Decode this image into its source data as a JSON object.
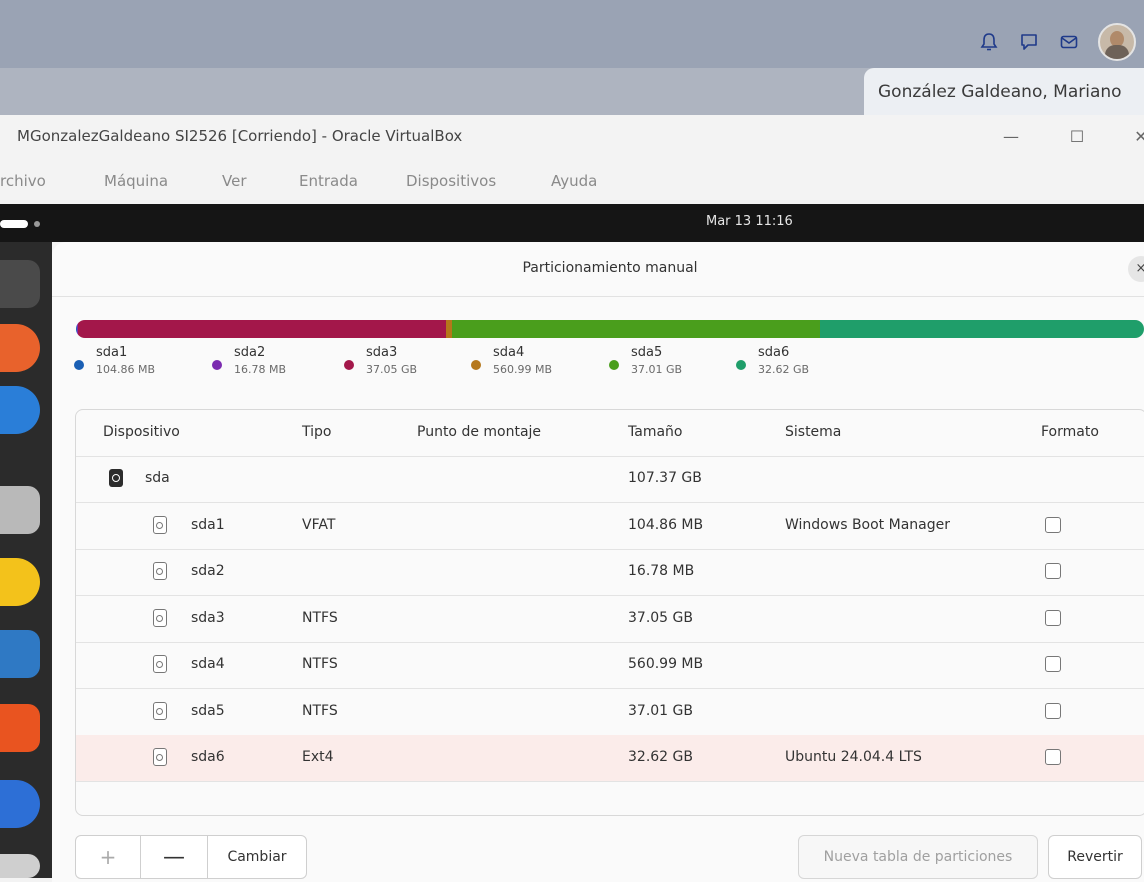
{
  "host": {
    "user_name": "González Galdeano, Mariano",
    "icons": [
      "bell-icon",
      "chat-icon",
      "mail-icon"
    ]
  },
  "vbox": {
    "title": "MGonzalezGaldeano SI2526 [Corriendo] - Oracle VirtualBox",
    "menu": [
      "rchivo",
      "Máquina",
      "Ver",
      "Entrada",
      "Dispositivos",
      "Ayuda"
    ]
  },
  "vm": {
    "clock": "Mar 13  11:16"
  },
  "dialog": {
    "title": "Particionamiento manual",
    "close": "×"
  },
  "partitions_bar": [
    {
      "name": "sda1",
      "size": "104.86 MB",
      "color": "#1a5fb4",
      "fraction": 0.001
    },
    {
      "name": "sda2",
      "size": "16.78 MB",
      "color": "#7b2bb0",
      "fraction": 0.0002
    },
    {
      "name": "sda3",
      "size": "37.05 GB",
      "color": "#a3174a",
      "fraction": 0.345
    },
    {
      "name": "sda4",
      "size": "560.99 MB",
      "color": "#b5771b",
      "fraction": 0.005
    },
    {
      "name": "sda5",
      "size": "37.01 GB",
      "color": "#4a9e1c",
      "fraction": 0.345
    },
    {
      "name": "sda6",
      "size": "32.62 GB",
      "color": "#1f9e6a",
      "fraction": 0.304
    }
  ],
  "table": {
    "headers": {
      "device": "Dispositivo",
      "type": "Tipo",
      "mount": "Punto de montaje",
      "size": "Tamaño",
      "system": "Sistema",
      "format": "Formato"
    },
    "disk": {
      "device": "sda",
      "size": "107.37 GB"
    },
    "rows": [
      {
        "device": "sda1",
        "type": "VFAT",
        "size": "104.86 MB",
        "system": "Windows Boot Manager"
      },
      {
        "device": "sda2",
        "type": "",
        "size": "16.78 MB",
        "system": ""
      },
      {
        "device": "sda3",
        "type": "NTFS",
        "size": "37.05 GB",
        "system": ""
      },
      {
        "device": "sda4",
        "type": "NTFS",
        "size": "560.99 MB",
        "system": ""
      },
      {
        "device": "sda5",
        "type": "NTFS",
        "size": "37.01 GB",
        "system": ""
      },
      {
        "device": "sda6",
        "type": "Ext4",
        "size": "32.62 GB",
        "system": "Ubuntu 24.04.4 LTS"
      }
    ]
  },
  "buttons": {
    "plus": "+",
    "minus": "—",
    "change": "Cambiar",
    "new_table": "Nueva tabla de particiones",
    "revert": "Revertir"
  }
}
